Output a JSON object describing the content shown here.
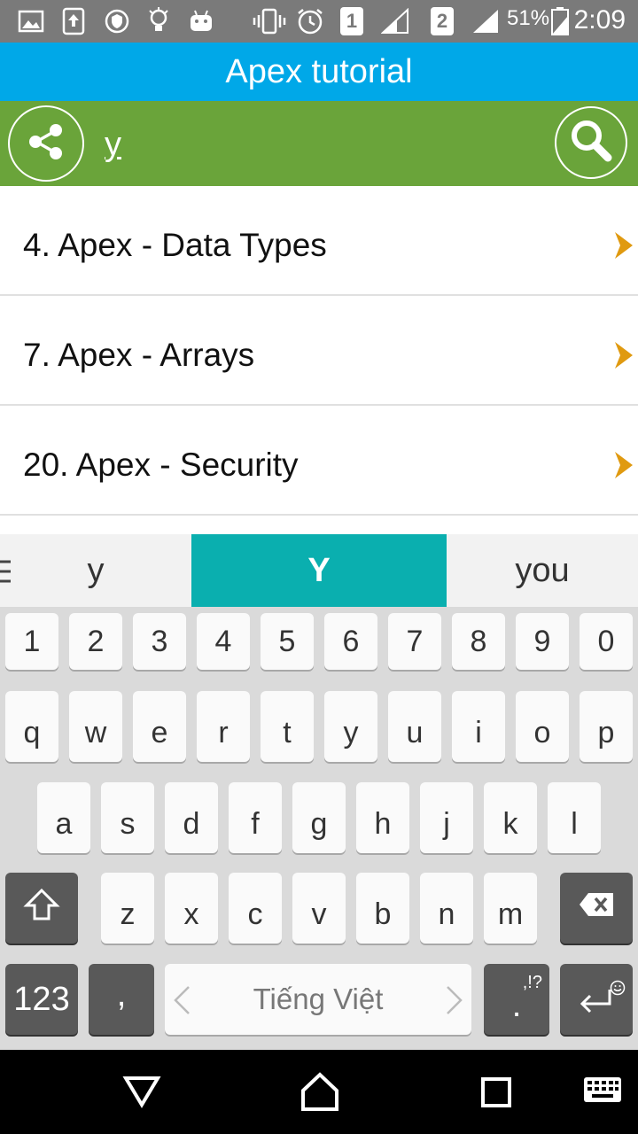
{
  "status_bar": {
    "sim1": "1",
    "sim2": "2",
    "battery": "51%",
    "time": "2:09",
    "icons": [
      "image-icon",
      "upload-icon",
      "shield-icon",
      "bulb-icon",
      "android-icon",
      "vibrate-icon",
      "alarm-icon",
      "signal-icon",
      "battery-icon"
    ]
  },
  "app": {
    "title": "Apex tutorial"
  },
  "search": {
    "value": "y",
    "share_icon": "share-icon",
    "search_icon": "search-icon"
  },
  "results": [
    {
      "label": "4. Apex - Data Types"
    },
    {
      "label": "7. Apex - Arrays"
    },
    {
      "label": "20. Apex - Security"
    }
  ],
  "suggestions": [
    "y",
    "Y",
    "you"
  ],
  "keyboard": {
    "number_row": [
      "1",
      "2",
      "3",
      "4",
      "5",
      "6",
      "7",
      "8",
      "9",
      "0"
    ],
    "row1": [
      "q",
      "w",
      "e",
      "r",
      "t",
      "y",
      "u",
      "i",
      "o",
      "p"
    ],
    "row2": [
      "a",
      "s",
      "d",
      "f",
      "g",
      "h",
      "j",
      "k",
      "l"
    ],
    "row3": [
      "z",
      "x",
      "c",
      "v",
      "b",
      "n",
      "m"
    ],
    "symbols_key": "123",
    "comma_key": ",",
    "space_label": "Tiếng Việt",
    "period_key": ".",
    "period_alt": ",!?",
    "accent_color": "#0aafaf"
  },
  "colors": {
    "title_bar": "#00a8e8",
    "search_bar": "#6aa43a",
    "chevron": "#e09a10"
  }
}
